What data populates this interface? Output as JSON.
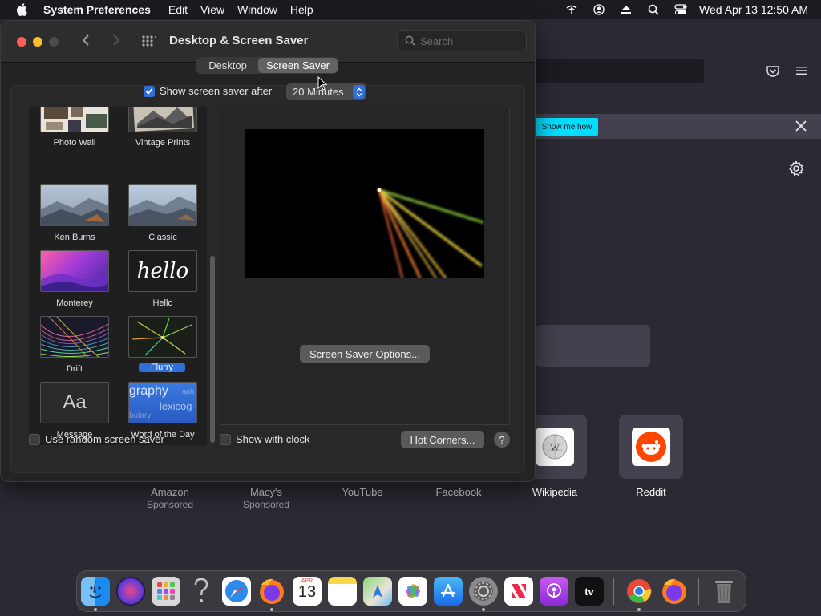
{
  "menubar": {
    "app_name": "System Preferences",
    "items": [
      "Edit",
      "View",
      "Window",
      "Help"
    ],
    "clock": "Wed Apr 13  12:50 AM",
    "status_icons": [
      "wifi-off-icon",
      "user-icon",
      "eject-icon",
      "search-icon",
      "control-center-icon"
    ]
  },
  "window": {
    "title": "Desktop & Screen Saver",
    "search_placeholder": "Search",
    "tabs": [
      {
        "label": "Desktop",
        "active": false
      },
      {
        "label": "Screen Saver",
        "active": true
      }
    ],
    "show_after_label": "Show screen saver after",
    "show_after_checked": true,
    "show_after_value": "20 Minutes",
    "savers": [
      {
        "label": "Photo Wall",
        "selected": false
      },
      {
        "label": "Vintage Prints",
        "selected": false
      },
      {
        "label": "Ken Burns",
        "selected": false
      },
      {
        "label": "Classic",
        "selected": false
      },
      {
        "label": "Monterey",
        "selected": false
      },
      {
        "label": "Hello",
        "selected": false
      },
      {
        "label": "Drift",
        "selected": false
      },
      {
        "label": "Flurry",
        "selected": true
      },
      {
        "label": "Message",
        "selected": false
      },
      {
        "label": "Word of the Day",
        "selected": false
      }
    ],
    "hello_text": "hello",
    "message_text": "Aa",
    "word_text_1": "graphy",
    "word_text_2": "lexicog",
    "word_text_3": "bulary",
    "word_text_4": "aph",
    "options_button": "Screen Saver Options...",
    "random_label": "Use random screen saver",
    "random_checked": false,
    "clock_label": "Show with clock",
    "clock_checked": false,
    "hot_corners_button": "Hot Corners...",
    "help_button": "?"
  },
  "browser": {
    "notice_button": "Show me how",
    "tiles": [
      {
        "label": "Amazon",
        "sub": "Sponsored"
      },
      {
        "label": "Macy's",
        "sub": "Sponsored"
      },
      {
        "label": "YouTube",
        "sub": ""
      },
      {
        "label": "Facebook",
        "sub": ""
      },
      {
        "label": "Wikipedia",
        "sub": ""
      },
      {
        "label": "Reddit",
        "sub": ""
      }
    ]
  },
  "dock": {
    "apps": [
      {
        "name": "Finder",
        "running": true
      },
      {
        "name": "Siri",
        "running": false
      },
      {
        "name": "Launchpad",
        "running": false
      },
      {
        "name": "Help",
        "running": false
      },
      {
        "name": "Safari",
        "running": false
      },
      {
        "name": "Firefox",
        "running": true
      },
      {
        "name": "Calendar",
        "running": false,
        "month": "APR",
        "day": "13"
      },
      {
        "name": "Notes",
        "running": false
      },
      {
        "name": "Maps",
        "running": false
      },
      {
        "name": "Photos",
        "running": false
      },
      {
        "name": "App Store",
        "running": false
      },
      {
        "name": "System Preferences",
        "running": true
      },
      {
        "name": "News",
        "running": false
      },
      {
        "name": "Podcasts",
        "running": false
      },
      {
        "name": "TV",
        "running": false,
        "label": "tv"
      },
      {
        "name": "Chrome",
        "running": true
      },
      {
        "name": "Firefox",
        "running": false
      },
      {
        "name": "Trash",
        "running": false
      }
    ]
  },
  "colors": {
    "accent": "#2e6fd8",
    "notice_button": "#00ddff"
  }
}
